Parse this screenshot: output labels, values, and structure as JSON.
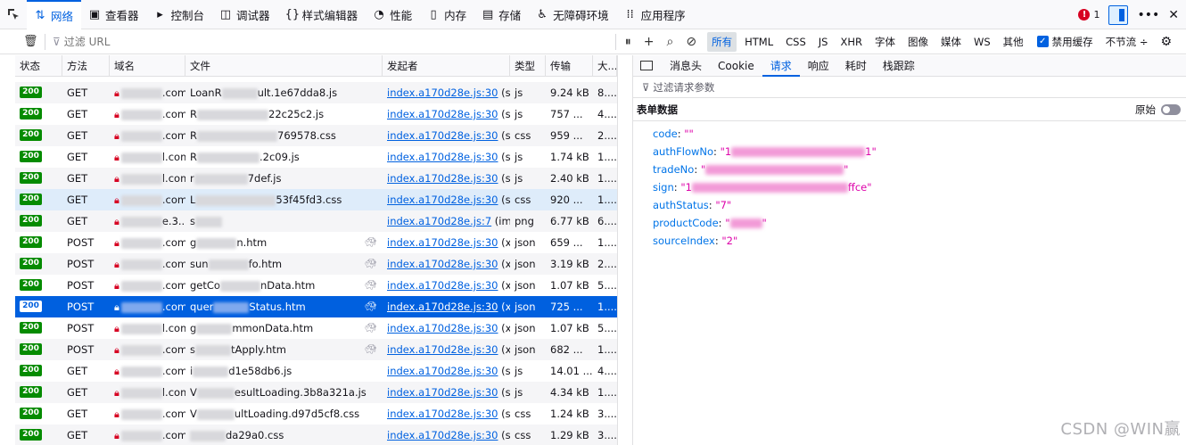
{
  "toolbar": {
    "tools": [
      {
        "label": "网络",
        "icon": "network-arrows-icon",
        "glyph": "⇅",
        "selected": true
      },
      {
        "label": "查看器",
        "icon": "inspector-icon",
        "glyph": "▣"
      },
      {
        "label": "控制台",
        "icon": "console-icon",
        "glyph": "▸"
      },
      {
        "label": "调试器",
        "icon": "debugger-icon",
        "glyph": "◫"
      },
      {
        "label": "样式编辑器",
        "icon": "style-editor-icon",
        "glyph": "{}"
      },
      {
        "label": "性能",
        "icon": "performance-icon",
        "glyph": "◔"
      },
      {
        "label": "内存",
        "icon": "memory-icon",
        "glyph": "▯"
      },
      {
        "label": "存储",
        "icon": "storage-icon",
        "glyph": "▤"
      },
      {
        "label": "无障碍环境",
        "icon": "accessibility-icon",
        "glyph": "♿"
      },
      {
        "label": "应用程序",
        "icon": "application-grid-icon",
        "glyph": "⁞⁞"
      }
    ],
    "error_count": "1"
  },
  "filterbar": {
    "placeholder": "过滤 URL",
    "types": [
      "所有",
      "HTML",
      "CSS",
      "JS",
      "XHR",
      "字体",
      "图像",
      "媒体",
      "WS",
      "其他"
    ],
    "active_type": "所有",
    "disable_cache_label": "禁用缓存",
    "throttle_label": "不节流 ÷"
  },
  "table": {
    "headers": [
      "状态",
      "方法",
      "域名",
      "文件",
      "发起者",
      "类型",
      "传输",
      "大..."
    ],
    "rows": [
      {
        "status": "200",
        "method": "GET",
        "domain_tail": ".com",
        "file_pre": "LoanR",
        "file_post": "ult.1e67dda8.js",
        "initiator": "index.a170d28e.js:30",
        "init_suffix": " (s...",
        "type": "js",
        "transfer": "9.24 kB",
        "size": "8...."
      },
      {
        "status": "200",
        "method": "GET",
        "domain_tail": ".com",
        "file_pre": "R",
        "file_post": "22c25c2.js",
        "initiator": "index.a170d28e.js:30",
        "init_suffix": " (s...",
        "type": "js",
        "transfer": "757 ...",
        "size": "4...."
      },
      {
        "status": "200",
        "method": "GET",
        "domain_tail": ".com",
        "file_pre": "R",
        "file_post": "769578.css",
        "initiator": "index.a170d28e.js:30",
        "init_suffix": " (s...",
        "type": "css",
        "transfer": "959 ...",
        "size": "2...."
      },
      {
        "status": "200",
        "method": "GET",
        "domain_tail": "l.com",
        "file_pre": "R",
        "file_post": ".2c09.js",
        "initiator": "index.a170d28e.js:30",
        "init_suffix": " (s...",
        "type": "js",
        "transfer": "1.74 kB",
        "size": "1...."
      },
      {
        "status": "200",
        "method": "GET",
        "domain_tail": "l.com",
        "file_pre": "r",
        "file_post": "7def.js",
        "initiator": "index.a170d28e.js:30",
        "init_suffix": " (s...",
        "type": "js",
        "transfer": "2.40 kB",
        "size": "1...."
      },
      {
        "status": "200",
        "method": "GET",
        "domain_tail": ".com",
        "file_pre": "L",
        "file_post": "53f45fd3.css",
        "initiator": "index.a170d28e.js:30",
        "init_suffix": " (s...",
        "type": "css",
        "transfer": "920 ...",
        "size": "1....",
        "highlight": true
      },
      {
        "status": "200",
        "method": "GET",
        "domain_tail": "e.3...",
        "file_pre": "s",
        "file_post": "",
        "initiator": "index.a170d28e.js:7",
        "init_suffix": " (im...",
        "type": "png",
        "transfer": "6.77 kB",
        "size": "6...."
      },
      {
        "status": "200",
        "method": "POST",
        "domain_tail": ".com",
        "file_pre": "g",
        "file_post": "n.htm",
        "initiator": "index.a170d28e.js:30",
        "init_suffix": " (x...",
        "type": "json",
        "transfer": "659 ...",
        "size": "1....",
        "slow": true
      },
      {
        "status": "200",
        "method": "POST",
        "domain_tail": ".com",
        "file_pre": "sun",
        "file_post": "fo.htm",
        "initiator": "index.a170d28e.js:30",
        "init_suffix": " (x...",
        "type": "json",
        "transfer": "3.19 kB",
        "size": "2....",
        "slow": true
      },
      {
        "status": "200",
        "method": "POST",
        "domain_tail": ".com",
        "file_pre": "getCo",
        "file_post": "nData.htm",
        "initiator": "index.a170d28e.js:30",
        "init_suffix": " (x...",
        "type": "json",
        "transfer": "1.07 kB",
        "size": "5....",
        "slow": true
      },
      {
        "status": "200",
        "method": "POST",
        "domain_tail": ".com",
        "file_pre": "quer",
        "file_post": "Status.htm",
        "initiator": "index.a170d28e.js:30",
        "init_suffix": " (x...",
        "type": "json",
        "transfer": "725 ...",
        "size": "1....",
        "slow": true,
        "selected": true
      },
      {
        "status": "200",
        "method": "POST",
        "domain_tail": "l.com",
        "file_pre": "g",
        "file_post": "mmonData.htm",
        "initiator": "index.a170d28e.js:30",
        "init_suffix": " (x...",
        "type": "json",
        "transfer": "1.07 kB",
        "size": "5....",
        "slow": true
      },
      {
        "status": "200",
        "method": "POST",
        "domain_tail": ".com",
        "file_pre": "s",
        "file_post": "tApply.htm",
        "initiator": "index.a170d28e.js:30",
        "init_suffix": " (x...",
        "type": "json",
        "transfer": "682 ...",
        "size": "1....",
        "slow": true
      },
      {
        "status": "200",
        "method": "GET",
        "domain_tail": ".com",
        "file_pre": "i",
        "file_post": "d1e58db6.js",
        "initiator": "index.a170d28e.js:30",
        "init_suffix": " (s...",
        "type": "js",
        "transfer": "14.01 ...",
        "size": "4...."
      },
      {
        "status": "200",
        "method": "GET",
        "domain_tail": "l.com",
        "file_pre": "V",
        "file_post": "esultLoading.3b8a321a.js",
        "initiator": "index.a170d28e.js:30",
        "init_suffix": " (s...",
        "type": "js",
        "transfer": "4.34 kB",
        "size": "1...."
      },
      {
        "status": "200",
        "method": "GET",
        "domain_tail": ".com",
        "file_pre": "V",
        "file_post": "ultLoading.d97d5cf8.css",
        "initiator": "index.a170d28e.js:30",
        "init_suffix": " (s...",
        "type": "css",
        "transfer": "1.24 kB",
        "size": "3...."
      },
      {
        "status": "200",
        "method": "GET",
        "domain_tail": ".com",
        "file_pre": "",
        "file_post": "da29a0.css",
        "initiator": "index.a170d28e.js:30",
        "init_suffix": " (s...",
        "type": "css",
        "transfer": "1.29 kB",
        "size": "3...."
      }
    ]
  },
  "panel": {
    "tabs": [
      "消息头",
      "Cookie",
      "请求",
      "响应",
      "耗时",
      "栈跟踪"
    ],
    "active_tab": "请求",
    "filter_placeholder": "过滤请求参数",
    "section_title": "表单数据",
    "raw_label": "原始",
    "params": [
      {
        "key": "code",
        "value": "\"\""
      },
      {
        "key": "authFlowNo",
        "value": "\"1"
      },
      {
        "key": "tradeNo",
        "value": "\""
      },
      {
        "key": "sign",
        "value": "\"1"
      },
      {
        "key": "authStatus",
        "value": "\"7\""
      },
      {
        "key": "productCode",
        "value": "\""
      },
      {
        "key": "sourceIndex",
        "value": "\"2\""
      }
    ],
    "param_tails": [
      "",
      "1\"",
      "\"",
      "ffce\"",
      "",
      "\"",
      ""
    ]
  },
  "watermark": "CSDN @WIN赢"
}
